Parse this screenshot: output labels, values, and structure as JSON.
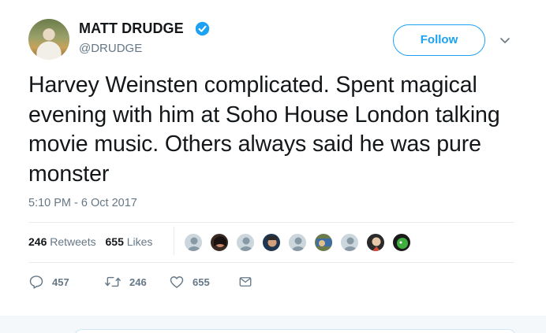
{
  "user": {
    "name": "MATT DRUDGE",
    "handle": "@DRUDGE",
    "verified_icon": "verified-badge-icon",
    "avatar_icon": "user-avatar"
  },
  "follow_label": "Follow",
  "tweet": {
    "text": "Harvey Weinsten complicated. Spent magical evening with him at Soho House London talking movie music. Others always said he was pure monster",
    "timestamp": "5:10 PM - 6 Oct 2017"
  },
  "stats": {
    "retweets_count": "246",
    "retweets_label": "Retweets",
    "likes_count": "655",
    "likes_label": "Likes"
  },
  "actions": {
    "replies": "457",
    "retweets": "246",
    "likes": "655"
  },
  "colors": {
    "accent": "#1da1f2",
    "muted": "#657786",
    "divider": "#e6ecf0"
  }
}
